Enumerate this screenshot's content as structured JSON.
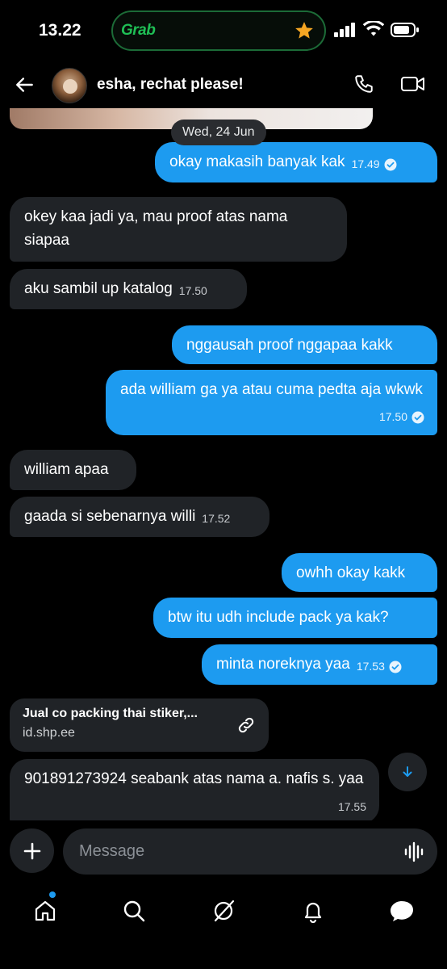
{
  "status_bar": {
    "time": "13.22",
    "pill_app": "Grab"
  },
  "header": {
    "title": "esha, rechat please!"
  },
  "date_separator": "Wed, 24 Jun",
  "messages": [
    {
      "dir": "out",
      "text": "okay makasih banyak kak",
      "time": "17.49",
      "read": true
    },
    {
      "dir": "in",
      "text": "okey kaa jadi ya, mau proof  atas nama siapaa"
    },
    {
      "dir": "in",
      "text": "aku sambil up katalog",
      "time": "17.50"
    },
    {
      "dir": "out",
      "text": "nggausah proof nggapaa kakk"
    },
    {
      "dir": "out",
      "text": "ada william ga ya atau cuma pedta aja wkwk",
      "time": "17.50",
      "read": true
    },
    {
      "dir": "in",
      "text": "william apaa"
    },
    {
      "dir": "in",
      "text": "gaada si sebenarnya willi",
      "time": "17.52"
    },
    {
      "dir": "out",
      "text": "owhh okay kakk"
    },
    {
      "dir": "out",
      "text": "btw itu udh include pack ya kak?"
    },
    {
      "dir": "out",
      "text": "minta noreknya yaa",
      "time": "17.53",
      "read": true
    },
    {
      "dir": "in",
      "text": "901891273924 seabank atas nama a. nafis s. yaa",
      "time": "17.55"
    }
  ],
  "link_card": {
    "title": "Jual co packing thai stiker,...",
    "domain": "id.shp.ee"
  },
  "composer": {
    "placeholder": "Message"
  },
  "tabs": [
    "home",
    "search",
    "grok",
    "notifications",
    "messages"
  ],
  "colors": {
    "accent": "#1d9bf0",
    "incoming_bubble": "#202327",
    "background": "#000000",
    "grab_green": "#1fbf55"
  }
}
